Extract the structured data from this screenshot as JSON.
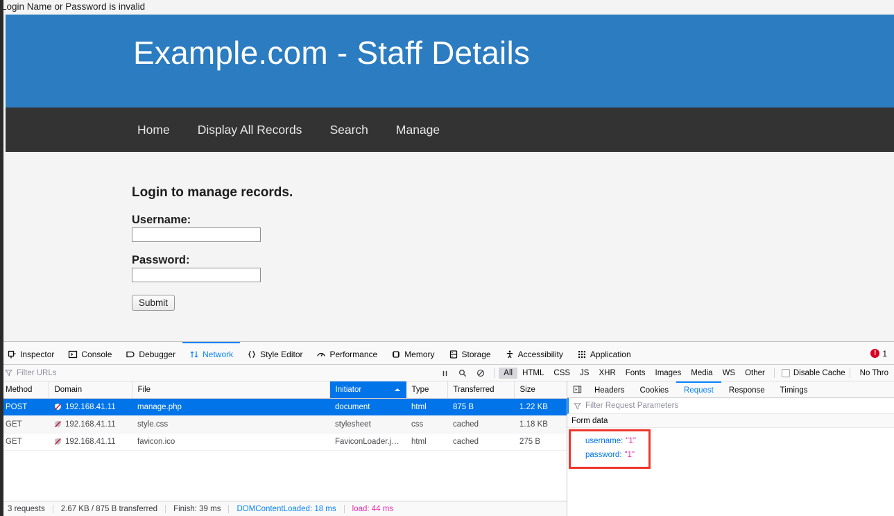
{
  "page": {
    "alert_text": "Login Name or Password is invalid",
    "site_title": "Example.com - Staff Details",
    "nav": [
      {
        "label": "Home"
      },
      {
        "label": "Display All Records"
      },
      {
        "label": "Search"
      },
      {
        "label": "Manage"
      }
    ],
    "form": {
      "heading": "Login to manage records.",
      "username_label": "Username:",
      "username_value": "",
      "password_label": "Password:",
      "password_value": "",
      "submit_label": "Submit"
    },
    "colors": {
      "header_blue": "#2b7cc0",
      "nav_dark": "#333333",
      "body_bg": "#f4f4f4"
    }
  },
  "devtools": {
    "tabs": [
      {
        "label": "Inspector",
        "icon": "inspector-icon",
        "active": false
      },
      {
        "label": "Console",
        "icon": "console-icon",
        "active": false
      },
      {
        "label": "Debugger",
        "icon": "debugger-icon",
        "active": false
      },
      {
        "label": "Network",
        "icon": "network-icon",
        "active": true
      },
      {
        "label": "Style Editor",
        "icon": "style-editor-icon",
        "active": false
      },
      {
        "label": "Performance",
        "icon": "performance-icon",
        "active": false
      },
      {
        "label": "Memory",
        "icon": "memory-icon",
        "active": false
      },
      {
        "label": "Storage",
        "icon": "storage-icon",
        "active": false
      },
      {
        "label": "Accessibility",
        "icon": "accessibility-icon",
        "active": false
      },
      {
        "label": "Application",
        "icon": "application-icon",
        "active": false
      }
    ],
    "error_count": "1",
    "toolbar": {
      "filter_placeholder": "Filter URLs",
      "type_filters": [
        {
          "label": "All",
          "active": true
        },
        {
          "label": "HTML",
          "active": false
        },
        {
          "label": "CSS",
          "active": false
        },
        {
          "label": "JS",
          "active": false
        },
        {
          "label": "XHR",
          "active": false
        },
        {
          "label": "Fonts",
          "active": false
        },
        {
          "label": "Images",
          "active": false
        },
        {
          "label": "Media",
          "active": false
        },
        {
          "label": "WS",
          "active": false
        },
        {
          "label": "Other",
          "active": false
        }
      ],
      "disable_cache_label": "Disable Cache",
      "disable_cache_checked": false,
      "throttle_label": "No Thro"
    },
    "table": {
      "columns": [
        {
          "label": "Method",
          "sorted": false
        },
        {
          "label": "Domain",
          "sorted": false
        },
        {
          "label": "File",
          "sorted": false
        },
        {
          "label": "Initiator",
          "sorted": true
        },
        {
          "label": "Type",
          "sorted": false
        },
        {
          "label": "Transferred",
          "sorted": false
        },
        {
          "label": "Size",
          "sorted": false
        }
      ],
      "rows": [
        {
          "method": "POST",
          "domain": "192.168.41.11",
          "file": "manage.php",
          "initiator": "document",
          "initiator_link": false,
          "type": "html",
          "transferred": "875 B",
          "size": "1.22 KB",
          "selected": true,
          "security_icon": "insecure-connection-icon"
        },
        {
          "method": "GET",
          "domain": "192.168.41.11",
          "file": "style.css",
          "initiator": "stylesheet",
          "initiator_link": false,
          "type": "css",
          "transferred": "cached",
          "size": "1.18 KB",
          "selected": false,
          "security_icon": "insecure-connection-icon"
        },
        {
          "method": "GET",
          "domain": "192.168.41.11",
          "file": "favicon.ico",
          "initiator": "FaviconLoader.jsm…",
          "initiator_link": true,
          "type": "html",
          "transferred": "cached",
          "size": "275 B",
          "selected": false,
          "security_icon": "insecure-connection-icon"
        }
      ]
    },
    "status_bar": {
      "requests": "3 requests",
      "transferred": "2.67 KB / 875 B transferred",
      "finish": "Finish: 39 ms",
      "dom_content_loaded": "DOMContentLoaded: 18 ms",
      "load": "load: 44 ms"
    },
    "details": {
      "tabs": [
        {
          "label": "Headers",
          "active": false
        },
        {
          "label": "Cookies",
          "active": false
        },
        {
          "label": "Request",
          "active": true
        },
        {
          "label": "Response",
          "active": false
        },
        {
          "label": "Timings",
          "active": false
        }
      ],
      "filter_placeholder": "Filter Request Parameters",
      "section_label": "Form data",
      "params": [
        {
          "key": "username:",
          "value": "\"1\""
        },
        {
          "key": "password:",
          "value": "\"1\""
        }
      ],
      "annotation_color": "#f0352b"
    }
  }
}
